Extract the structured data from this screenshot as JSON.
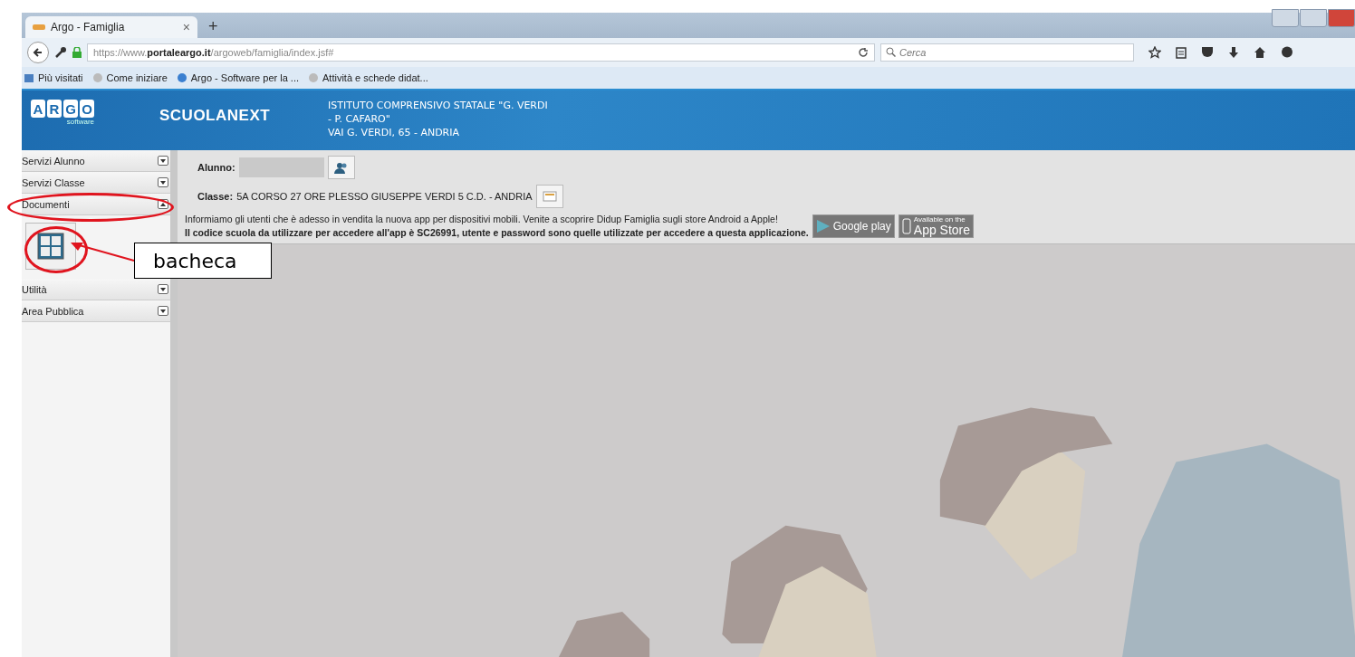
{
  "browser": {
    "tab": {
      "title": "Argo - Famiglia",
      "close": "×",
      "selected": true
    },
    "new_tab": "+",
    "url": "https://www.**portaleargo.it**/argoweb/famiglia/index.jsf#",
    "search": {
      "placeholder": "Cerca"
    },
    "bookmarks": [
      {
        "kind": "folder",
        "label": "Più visitati"
      },
      {
        "kind": "globe",
        "label": "Come iniziare"
      },
      {
        "kind": "site",
        "label": "Argo - Software per la ..."
      },
      {
        "kind": "globe",
        "label": "Attività e schede didat..."
      }
    ]
  },
  "header": {
    "logo_letters": [
      "A",
      "R",
      "G",
      "O"
    ],
    "logo_sub": "software",
    "product": "SCUOLANEXT",
    "school_lines": [
      "ISTITUTO COMPRENSIVO STATALE \"G. VERDI",
      "- P. CAFARO\"",
      "VAI G. VERDI, 65 - ANDRIA"
    ]
  },
  "sidebar": {
    "items": [
      {
        "label": "Servizi Alunno",
        "expanded": false
      },
      {
        "label": "Servizi Classe",
        "expanded": false
      },
      {
        "label": "Documenti",
        "expanded": true
      },
      {
        "label": "Utilità",
        "expanded": false
      },
      {
        "label": "Area Pubblica",
        "expanded": false
      }
    ]
  },
  "student": {
    "label": "Alunno:"
  },
  "class": {
    "label": "Classe:",
    "value": "5A CORSO 27 ORE PLESSO GIUSEPPE VERDI 5 C.D. - ANDRIA"
  },
  "notice": {
    "lines": [
      {
        "text": "Informiamo gli utenti che è adesso in vendita la nuova app per dispositivi mobili. Venite a scoprire Didup Famiglia sugli store Android a Apple!",
        "bold": false
      },
      {
        "text": "Il codice scuola da utilizzare per accedere all'app è SC26991, utente e password sono quelle utilizzate per accedere a questa applicazione.",
        "bold": true
      }
    ],
    "badges": [
      {
        "kind": "google-play",
        "label": "Google play"
      },
      {
        "kind": "app-store",
        "caption": "Available on the",
        "label": "App Store"
      }
    ]
  },
  "annotation": {
    "callout": "bacheca"
  }
}
